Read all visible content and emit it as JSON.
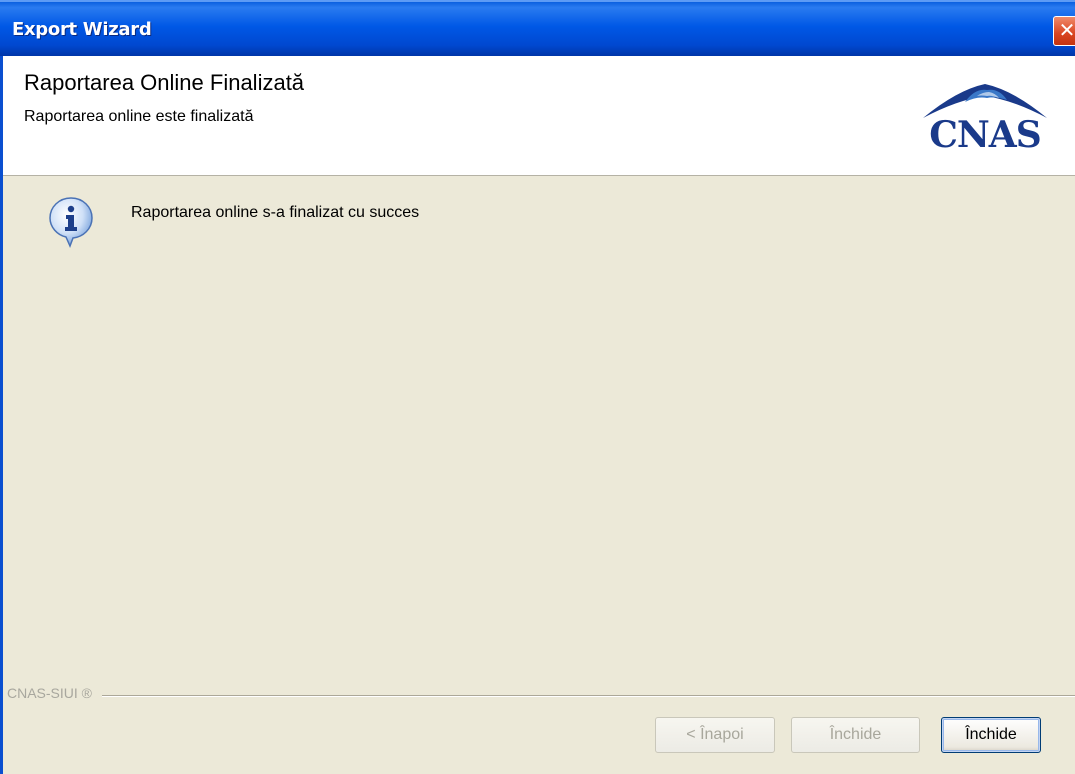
{
  "window": {
    "title": "Export Wizard",
    "close_glyph": "✕"
  },
  "header": {
    "title": "Raportarea Online Finalizată",
    "subtitle": "Raportarea online este finalizată",
    "logo_text": "CNAS"
  },
  "content": {
    "icon": "info-icon",
    "message": "Raportarea online s-a finalizat cu succes"
  },
  "footer": {
    "label": "CNAS-SIUI ®"
  },
  "buttons": {
    "back": "< Înapoi",
    "close_disabled": "Închide",
    "close": "Închide"
  },
  "colors": {
    "titlebar": "#0054e3",
    "content_bg": "#ece9d8",
    "logo_blue": "#1a3a8a",
    "close_red": "#d94421"
  }
}
